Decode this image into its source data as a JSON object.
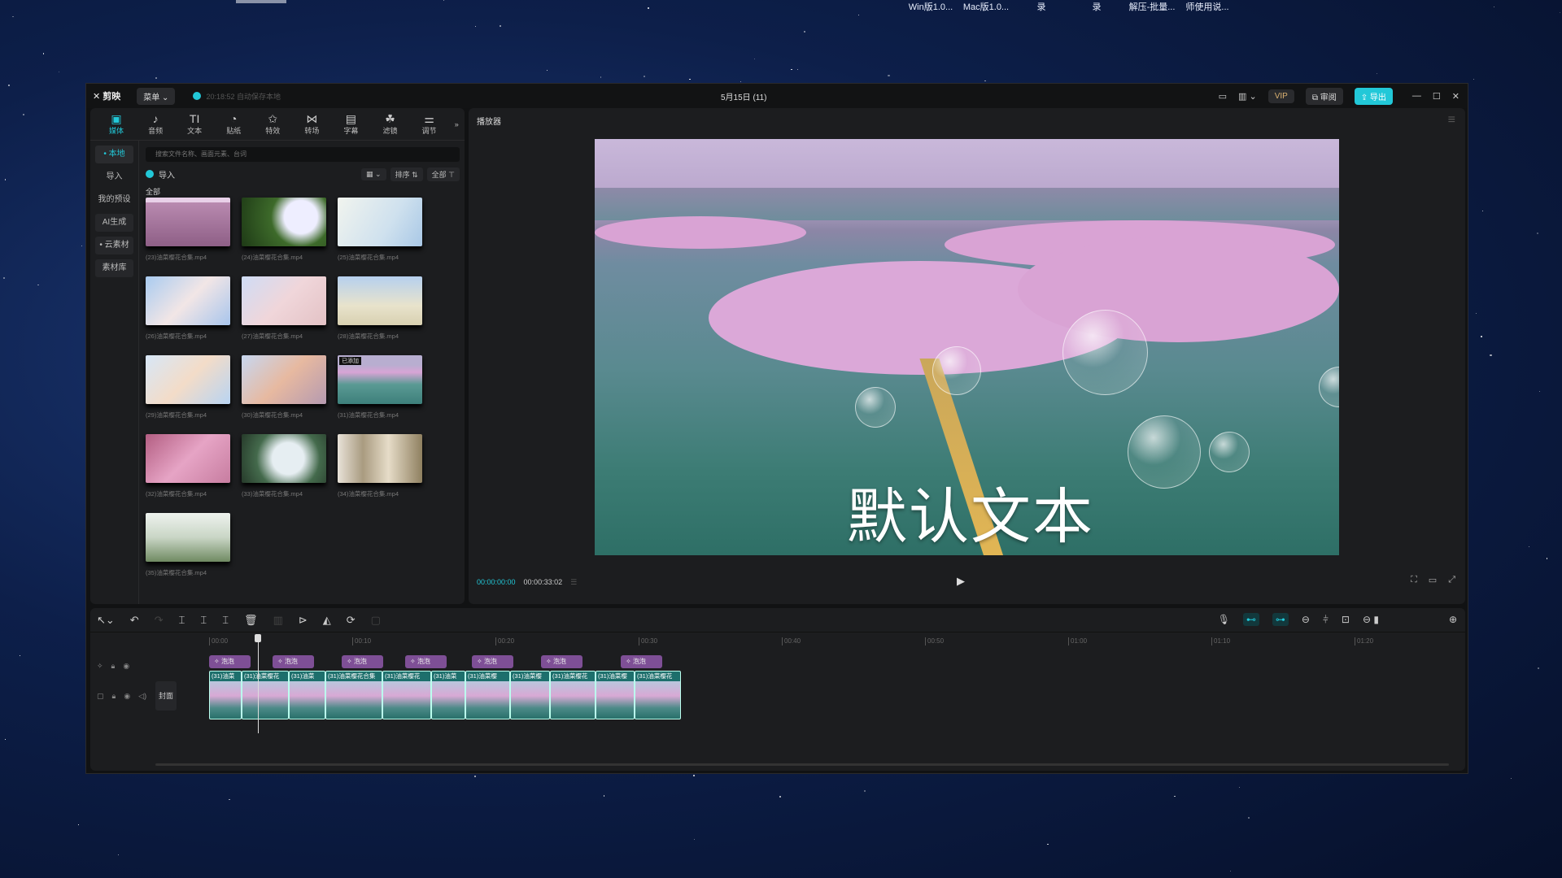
{
  "desktop": {
    "shortcuts": [
      "Win版1.0...",
      "Mac版1.0...",
      "录",
      "录",
      "解压-批量...",
      "师使用说..."
    ]
  },
  "app": {
    "name": "剪映",
    "menu": "菜单",
    "autosave": "20:18:52 自动保存本地",
    "project_title": "5月15日 (11)",
    "title_actions": {
      "vip": "VIP",
      "review": "审阅",
      "export": "导出"
    }
  },
  "toolbar": {
    "items": [
      {
        "label": "媒体",
        "icon": "media-icon",
        "active": true
      },
      {
        "label": "音频",
        "icon": "audio-icon"
      },
      {
        "label": "文本",
        "icon": "text-icon"
      },
      {
        "label": "贴纸",
        "icon": "sticker-icon"
      },
      {
        "label": "特效",
        "icon": "effects-icon"
      },
      {
        "label": "转场",
        "icon": "transition-icon"
      },
      {
        "label": "字幕",
        "icon": "subtitle-icon"
      },
      {
        "label": "滤镜",
        "icon": "filter-icon"
      },
      {
        "label": "调节",
        "icon": "adjust-icon"
      }
    ],
    "more": "»"
  },
  "media": {
    "sidebar": [
      "本地",
      "导入",
      "我的预设",
      "AI生成",
      "云素材",
      "素材库"
    ],
    "search_placeholder": "搜索文件名称、画面元素、台词",
    "import": "导入",
    "sort": "排序",
    "filter_all": "全部",
    "section": "全部",
    "added_badge": "已添加",
    "files": [
      "(23)油菜樱花合集.mp4",
      "(24)油菜樱花合集.mp4",
      "(25)油菜樱花合集.mp4",
      "(26)油菜樱花合集.mp4",
      "(27)油菜樱花合集.mp4",
      "(28)油菜樱花合集.mp4",
      "(29)油菜樱花合集.mp4",
      "(30)油菜樱花合集.mp4",
      "(31)油菜樱花合集.mp4",
      "(32)油菜樱花合集.mp4",
      "(33)油菜樱花合集.mp4",
      "(34)油菜樱花合集.mp4",
      "(35)油菜樱花合集.mp4"
    ]
  },
  "player": {
    "title": "播放器",
    "caption": "默认文本",
    "current_time": "00:00:00:00",
    "duration": "00:00:33:02"
  },
  "timeline": {
    "ruler": [
      "00:00",
      "00:10",
      "00:20",
      "00:30",
      "00:40",
      "00:50",
      "01:00",
      "01:10",
      "01:20"
    ],
    "effect_label": "泡泡",
    "effect_count": 7,
    "cover_label": "封面",
    "clips": [
      "(31)油菜",
      "(31)油菜樱花",
      "(31)油菜",
      "(31)油菜樱花合集",
      "(31)油菜樱花",
      "(31)油菜",
      "(31)油菜樱",
      "(31)油菜樱",
      "(31)油菜樱花",
      "(31)油菜樱",
      "(31)油菜樱花"
    ]
  },
  "colors": {
    "accent": "#22c8d8",
    "effect_chip": "#7e4f96",
    "panel": "#1c1d1f"
  }
}
